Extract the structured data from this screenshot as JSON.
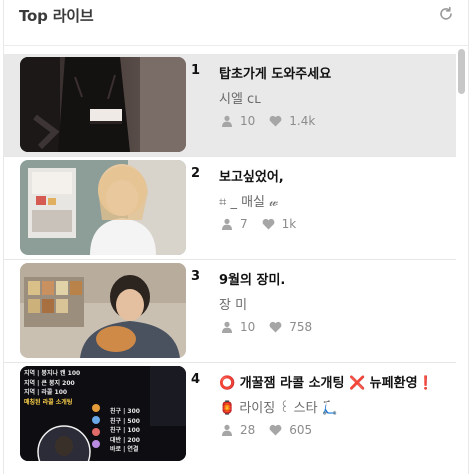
{
  "header": {
    "title": "Top 라이브",
    "refresh_icon": "refresh-icon"
  },
  "colors": {
    "active_row": "#e9e9e9",
    "muted_text": "#8c8c8c",
    "divider": "#e6e6e6"
  },
  "items": [
    {
      "rank": "1",
      "title": "탑초가게 도와주세요",
      "host": "시엘 ᴄʟ",
      "viewers": "10",
      "likes": "1.4k",
      "active": true
    },
    {
      "rank": "2",
      "title": "보고싶었어,",
      "host": "⌗ _ 매실 𝓌",
      "viewers": "7",
      "likes": "1k",
      "active": false
    },
    {
      "rank": "3",
      "title": "9월의 장미.",
      "host": "장 미",
      "viewers": "10",
      "likes": "758",
      "active": false
    },
    {
      "rank": "4",
      "title": "⭕ 개꿀잼 라콜 소개팅 ❌ 뉴페환영❗",
      "host": "🏮 라이징 ꒰ 스타 🛴",
      "viewers": "28",
      "likes": "605",
      "active": false
    }
  ],
  "thumb4_lines": [
    "지역 | 봉지나 캔 100",
    "지역 | 큰 봉지 200",
    "지역 | 라콜 100",
    "매칭된 라콜 소개팅",
    "친구 | 300",
    "친구 | 500",
    "친구 | 100",
    "대반 | 200",
    "바로 | 연결"
  ]
}
